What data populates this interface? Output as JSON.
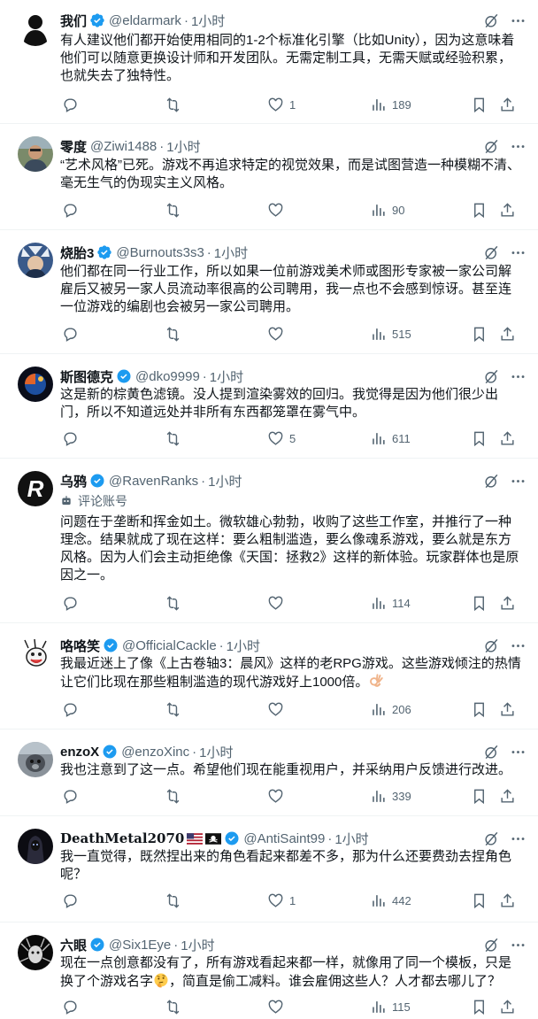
{
  "tweets": [
    {
      "display_name": "我们",
      "handle": "@eldarmark",
      "dot": "·",
      "time": "1小时",
      "verified": true,
      "text": "有人建议他们都开始使用相同的1-2个标准化引擎（比如Unity），因为这意味着他们可以随意更换设计师和开发团队。无需定制工具，无需天赋或经验积累，也就失去了独特性。",
      "replies": "",
      "retweets": "",
      "likes": "1",
      "views": "189",
      "avatar": "black-silhouette"
    },
    {
      "display_name": "零度",
      "handle": "@Ziwi1488",
      "dot": "·",
      "time": "1小时",
      "verified": false,
      "text": "“艺术风格”已死。游戏不再追求特定的视觉效果，而是试图营造一种模糊不清、毫无生气的伪现实主义风格。",
      "replies": "",
      "retweets": "",
      "likes": "",
      "views": "90",
      "avatar": "person-photo"
    },
    {
      "display_name": "烧胎3",
      "handle": "@Burnouts3s3",
      "dot": "·",
      "time": "1小时",
      "verified": true,
      "text": "他们都在同一行业工作，所以如果一位前游戏美术师或图形专家被一家公司解雇后又被另一家人员流动率很高的公司聘用，我一点也不会感到惊讶。甚至连一位游戏的编剧也会被另一家公司聘用。",
      "replies": "",
      "retweets": "",
      "likes": "",
      "views": "515",
      "avatar": "anime-character"
    },
    {
      "display_name": "斯图德克",
      "handle": "@dko9999",
      "dot": "·",
      "time": "1小时",
      "verified": true,
      "text": "这是新的棕黄色滤镜。没人提到渲染雾效的回归。我觉得是因为他们很少出门，所以不知道远处并非所有东西都笼罩在雾气中。",
      "replies": "",
      "retweets": "",
      "likes": "5",
      "views": "611",
      "avatar": "planet-art"
    },
    {
      "display_name": "乌鸦",
      "handle": "@RavenRanks",
      "dot": "·",
      "time": "1小时",
      "verified": true,
      "label": "评论账号",
      "text": "问题在于垄断和挥金如土。微软雄心勃勃，收购了这些工作室，并推行了一种理念。结果就成了现在这样：要么粗制滥造，要么像魂系游戏，要么就是东方风格。因为人们会主动拒绝像《天国：拯救2》这样的新体验。玩家群体也是原因之一。",
      "replies": "",
      "retweets": "",
      "likes": "",
      "views": "114",
      "avatar": "r-logo"
    },
    {
      "display_name": "咯咯笑",
      "handle": "@OfficialCackle",
      "dot": "·",
      "time": "1小时",
      "verified": true,
      "text": "我最近迷上了像《上古卷轴3：晨风》这样的老RPG游戏。这些游戏倾注的热情让它们比现在那些粗制滥造的现代游戏好上1000倍。",
      "replies": "",
      "retweets": "",
      "likes": "",
      "views": "206",
      "avatar": "cartoon-character"
    },
    {
      "display_name": "enzoX",
      "handle": "@enzoXinc",
      "dot": "·",
      "time": "1小时",
      "verified": true,
      "text": "我也注意到了这一点。希望他们现在能重视用户，并采纳用户反馈进行改进。",
      "replies": "",
      "retweets": "",
      "likes": "",
      "views": "339",
      "avatar": "animal-photo"
    },
    {
      "display_name": "DeathMetal2070",
      "handle": "@AntiSaint99",
      "dot": "·",
      "time": "1小时",
      "verified": true,
      "text": "我一直觉得，既然捏出来的角色看起来都差不多，那为什么还要费劲去捏角色呢？",
      "replies": "",
      "retweets": "",
      "likes": "1",
      "views": "442",
      "avatar": "dark-figure"
    },
    {
      "display_name": "六眼",
      "handle": "@Six1Eye",
      "dot": "·",
      "time": "1小时",
      "verified": true,
      "text": "现在一点创意都没有了，所有游戏看起来都一样，就像用了同一个模板，只是换了个游戏名字",
      "text2": "，简直是偷工减料。谁会雇佣这些人？人才都去哪儿了？",
      "replies": "",
      "retweets": "",
      "likes": "",
      "views": "115",
      "avatar": "white-creature"
    }
  ],
  "colors": {
    "text": "#0f1419",
    "secondary": "#536471",
    "verified": "#1d9bf0",
    "divider": "#eff3f4"
  },
  "icons": [
    "grok-slash-icon",
    "more-icon",
    "reply-icon",
    "retweet-icon",
    "like-icon",
    "views-icon",
    "bookmark-icon",
    "share-icon",
    "verified-icon"
  ]
}
